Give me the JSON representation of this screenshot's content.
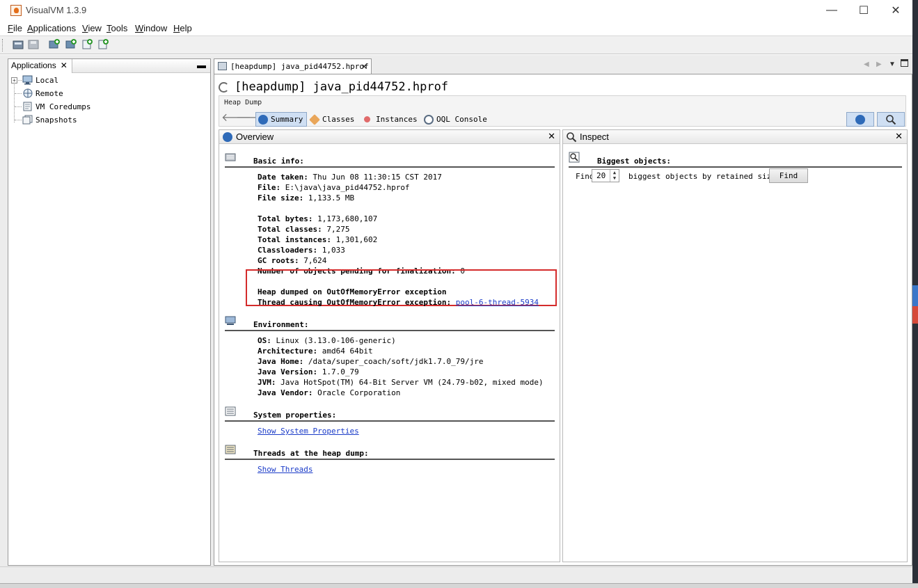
{
  "window": {
    "title": "VisualVM 1.3.9",
    "minimize_label": "—",
    "maximize_label": "☐",
    "close_label": "✕"
  },
  "menu": [
    {
      "key": "F",
      "rest": "ile"
    },
    {
      "key": "A",
      "rest": "pplications"
    },
    {
      "key": "V",
      "rest": "iew"
    },
    {
      "key": "T",
      "rest": "ools"
    },
    {
      "key": "W",
      "rest": "indow"
    },
    {
      "key": "H",
      "rest": "elp"
    }
  ],
  "applications": {
    "tab_label": "Applications",
    "close_glyph": "✕",
    "minimize_glyph": "▬",
    "tree": [
      {
        "label": "Local",
        "icon": "computer-icon",
        "expander": "+"
      },
      {
        "label": "Remote",
        "icon": "network-icon"
      },
      {
        "label": "VM Coredumps",
        "icon": "coredump-icon"
      },
      {
        "label": "Snapshots",
        "icon": "snapshots-icon"
      }
    ]
  },
  "editor": {
    "tab_label": "[heapdump] java_pid44752.hprof",
    "tab_close": "✕",
    "title": "[heapdump] java_pid44752.hprof",
    "subtitle": "Heap Dump",
    "views": [
      {
        "label": "Summary",
        "icon": "info-icon",
        "active": true
      },
      {
        "label": "Classes",
        "icon": "classes-icon",
        "active": false
      },
      {
        "label": "Instances",
        "icon": "instances-icon",
        "active": false
      },
      {
        "label": "OQL Console",
        "icon": "oql-icon",
        "active": false
      }
    ]
  },
  "overview": {
    "panel_title": "Overview",
    "close_glyph": "✕",
    "basic_info": {
      "heading": "Basic info:",
      "date_taken": {
        "label": "Date taken:",
        "value": "Thu Jun 08 11:30:15 CST 2017"
      },
      "file": {
        "label": "File:",
        "value": "E:\\java\\java_pid44752.hprof"
      },
      "file_size": {
        "label": "File size:",
        "value": "1,133.5 MB"
      },
      "total_bytes": {
        "label": "Total bytes:",
        "value": "1,173,680,107"
      },
      "total_classes": {
        "label": "Total classes:",
        "value": "7,275"
      },
      "total_instances": {
        "label": "Total instances:",
        "value": "1,301,602"
      },
      "classloaders": {
        "label": "Classloaders:",
        "value": "1,033"
      },
      "gc_roots": {
        "label": "GC roots:",
        "value": "7,624"
      },
      "pending_finalization": {
        "label": "Number of objects pending for finalization:",
        "value": "0"
      },
      "oom_heap": "Heap dumped on OutOfMemoryError exception",
      "oom_thread_label": "Thread causing OutOfMemoryError exception:",
      "oom_thread_link": "pool-6-thread-5934"
    },
    "environment": {
      "heading": "Environment:",
      "os": {
        "label": "OS:",
        "value": "Linux (3.13.0-106-generic)"
      },
      "architecture": {
        "label": "Architecture:",
        "value": "amd64 64bit"
      },
      "java_home": {
        "label": "Java Home:",
        "value": "/data/super_coach/soft/jdk1.7.0_79/jre"
      },
      "java_version": {
        "label": "Java Version:",
        "value": "1.7.0_79"
      },
      "jvm": {
        "label": "JVM:",
        "value": "Java HotSpot(TM) 64-Bit Server VM (24.79-b02, mixed mode)"
      },
      "java_vendor": {
        "label": "Java Vendor:",
        "value": "Oracle Corporation"
      }
    },
    "system_properties": {
      "heading": "System properties:",
      "link": "Show System Properties"
    },
    "threads": {
      "heading": "Threads at the heap dump:",
      "link": "Show Threads"
    }
  },
  "inspect": {
    "panel_title": "Inspect",
    "close_glyph": "✕",
    "heading": "Biggest objects:",
    "find_prefix": "Find",
    "find_count": "20",
    "find_suffix": "biggest objects by retained size:",
    "find_button": "Find"
  },
  "colors": {
    "highlight_box": "#d42b2b",
    "link": "#1a3bc8",
    "active_view": "#cfdff3"
  }
}
